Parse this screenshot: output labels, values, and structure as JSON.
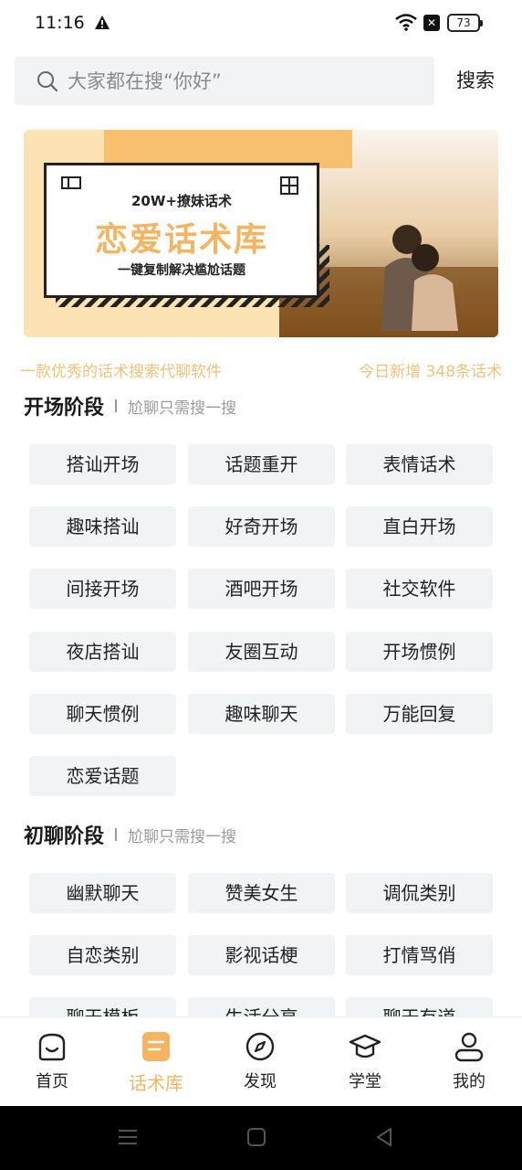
{
  "status_bar": {
    "time": "11:16",
    "battery": "73"
  },
  "search": {
    "placeholder": "大家都在搜“你好”",
    "button_label": "搜索"
  },
  "banner": {
    "subtitle": "20W+撩妹话术",
    "title": "恋爱话术库",
    "tagline": "一键复制解决尴尬话题"
  },
  "info": {
    "left": "一款优秀的话术搜索代聊软件",
    "right": "今日新增 348条话术"
  },
  "sections": [
    {
      "title": "开场阶段",
      "subtitle": "尬聊只需搜一搜",
      "chips": [
        "搭讪开场",
        "话题重开",
        "表情话术",
        "趣味搭讪",
        "好奇开场",
        "直白开场",
        "间接开场",
        "酒吧开场",
        "社交软件",
        "夜店搭讪",
        "友圈互动",
        "开场惯例",
        "聊天惯例",
        "趣味聊天",
        "万能回复",
        "恋爱话题"
      ]
    },
    {
      "title": "初聊阶段",
      "subtitle": "尬聊只需搜一搜",
      "chips": [
        "幽默聊天",
        "赞美女生",
        "调侃类别",
        "自恋类别",
        "影视话梗",
        "打情骂俏",
        "聊天模板",
        "生活分享",
        "聊天有道"
      ]
    }
  ],
  "tabs": [
    {
      "label": "首页",
      "icon": "home-icon"
    },
    {
      "label": "话术库",
      "icon": "chat-library-icon"
    },
    {
      "label": "发现",
      "icon": "compass-icon"
    },
    {
      "label": "学堂",
      "icon": "graduation-cap-icon"
    },
    {
      "label": "我的",
      "icon": "profile-icon"
    }
  ],
  "colors": {
    "accent": "#f5b560",
    "chip_bg": "#f2f3f5",
    "info_text": "#f3c27a"
  }
}
